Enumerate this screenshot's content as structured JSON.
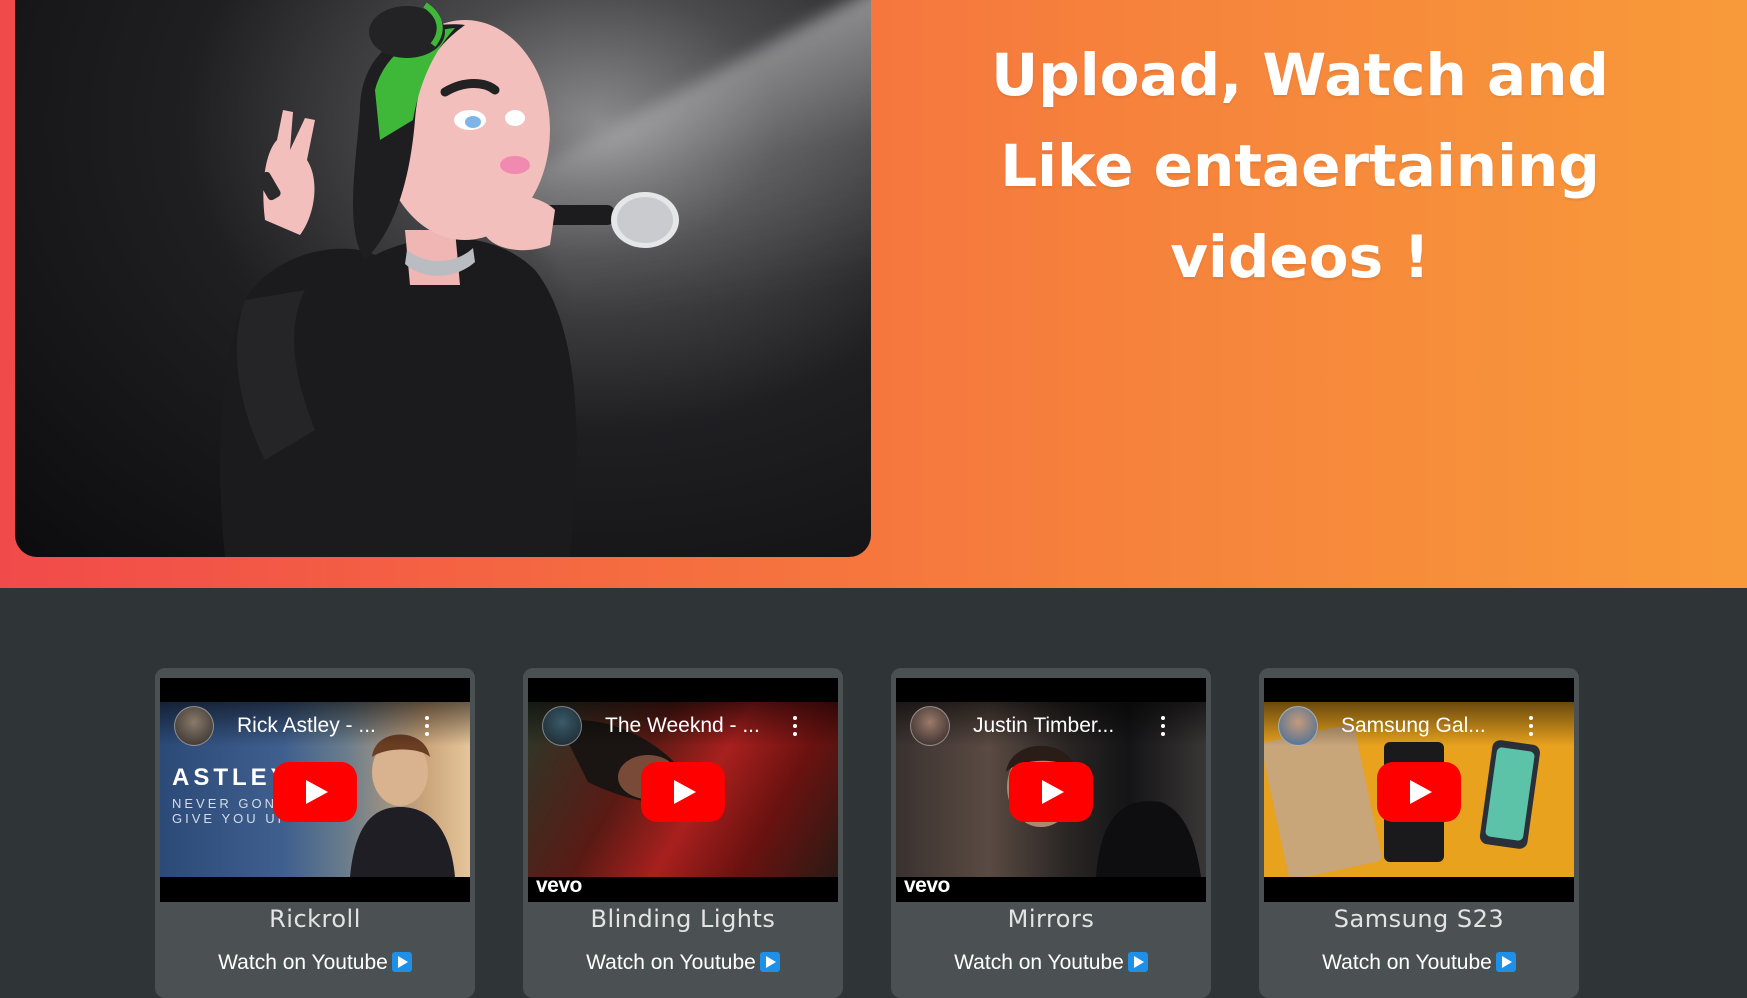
{
  "hero": {
    "title_line1": "Upload, Watch and",
    "title_line2": "Like entaertaining",
    "title_line3": "videos !"
  },
  "videos": [
    {
      "channel_title": "Rick Astley - ...",
      "name": "Rickroll",
      "link_label": "Watch on Youtube",
      "thumb_text_1": "ASTLEY",
      "thumb_text_2": "NEVER GONNA",
      "thumb_text_3": "GIVE YOU UP"
    },
    {
      "channel_title": "The Weeknd - ...",
      "name": "Blinding Lights",
      "link_label": "Watch on Youtube",
      "brand": "vevo"
    },
    {
      "channel_title": "Justin Timber...",
      "name": "Mirrors",
      "link_label": "Watch on Youtube",
      "brand": "vevo"
    },
    {
      "channel_title": "Samsung Gal...",
      "name": "Samsung S23",
      "link_label": "Watch on Youtube"
    }
  ],
  "colors": {
    "hero_gradient_start": "#f14a4a",
    "hero_gradient_end": "#f89a3a",
    "page_bg": "#2f3436",
    "card_bg": "#4b5153",
    "play_button": "#ff0000",
    "youtube_link_icon": "#1e90e8"
  },
  "icons": [
    "play-button-icon",
    "more-options-icon",
    "external-video-icon"
  ]
}
